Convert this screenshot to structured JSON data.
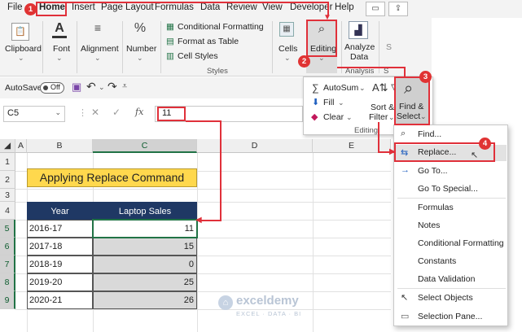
{
  "menu": {
    "items": [
      "File",
      "Home",
      "Insert",
      "Page Layout",
      "Formulas",
      "Data",
      "Review",
      "View",
      "Developer",
      "Help"
    ]
  },
  "ribbon": {
    "clipboard": "Clipboard",
    "font": "Font",
    "alignment": "Alignment",
    "number": "Number",
    "conditional_formatting": "Conditional Formatting",
    "format_as_table": "Format as Table",
    "cell_styles": "Cell Styles",
    "styles_group": "Styles",
    "cells": "Cells",
    "editing": "Editing",
    "analyze_data_line1": "Analyze",
    "analyze_data_line2": "Data",
    "analysis_group": "Analysis",
    "s_label": "S"
  },
  "qat": {
    "autosave_label": "AutoSave",
    "autosave_state": "Off"
  },
  "formula_bar": {
    "name_box": "C5",
    "fx": "fx",
    "value": "11"
  },
  "editing_panel": {
    "autosum": "AutoSum",
    "fill": "Fill",
    "clear": "Clear",
    "sort_filter_line1": "Sort &",
    "sort_filter_line2": "Filter",
    "find_select_line1": "Find &",
    "find_select_line2": "Select",
    "group_label": "Editing"
  },
  "find_menu": {
    "items": [
      "Find...",
      "Replace...",
      "Go To...",
      "Go To Special...",
      "Formulas",
      "Notes",
      "Conditional Formatting",
      "Constants",
      "Data Validation",
      "Select Objects",
      "Selection Pane..."
    ]
  },
  "grid": {
    "columns": [
      "A",
      "B",
      "C",
      "D",
      "E"
    ],
    "rows": [
      "1",
      "2",
      "3",
      "4",
      "5",
      "6",
      "7",
      "8",
      "9"
    ],
    "title": "Applying Replace Command",
    "headers": [
      "Year",
      "Laptop Sales"
    ],
    "data": [
      {
        "year": "2016-17",
        "sales": "11"
      },
      {
        "year": "2017-18",
        "sales": "15"
      },
      {
        "year": "2018-19",
        "sales": "0"
      },
      {
        "year": "2019-20",
        "sales": "25"
      },
      {
        "year": "2020-21",
        "sales": "26"
      }
    ]
  },
  "watermark": {
    "name": "exceldemy",
    "tagline": "EXCEL · DATA · BI"
  },
  "steps": [
    "1",
    "2",
    "3",
    "4"
  ],
  "colors": {
    "accent_green": "#217346",
    "title_fill": "#ffd84d",
    "header_fill": "#1f3864",
    "highlight_red": "#e0303a",
    "selection_gray": "#d9d9d9"
  }
}
